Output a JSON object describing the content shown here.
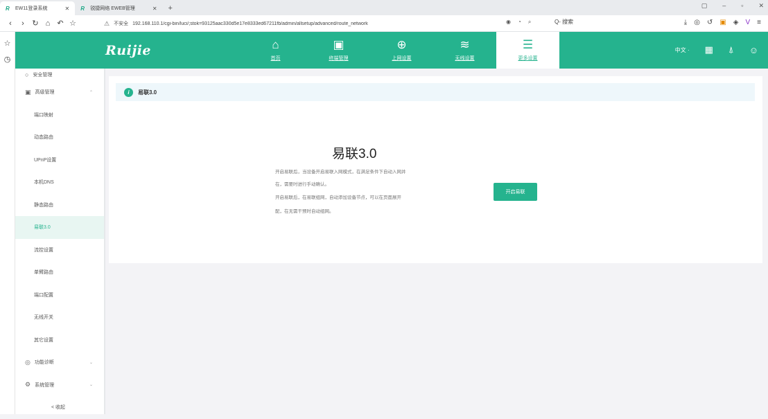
{
  "browser": {
    "tabs": [
      {
        "title": "EW11登录系统",
        "active": true
      },
      {
        "title": "锐捷网络 EWEB管理",
        "active": false
      }
    ],
    "window_controls": [
      "▢",
      "–",
      "▫",
      "✕"
    ],
    "security_label": "不安全",
    "url": "192.168.110.1/cgi-bin/luci/;stok=93125aac330d5e17e8333ed67211fb/admin/allsetup/advanced/route_network",
    "search_text": "Q- 搜索"
  },
  "header": {
    "logo": "Ruijie",
    "menu": [
      {
        "label": "首页",
        "icon": "home-icon",
        "glyph": "⌂",
        "active": false
      },
      {
        "label": "终端管理",
        "icon": "devices-icon",
        "glyph": "▣",
        "active": false
      },
      {
        "label": "上网设置",
        "icon": "globe-icon",
        "glyph": "⊕",
        "active": false
      },
      {
        "label": "无线设置",
        "icon": "wifi-icon",
        "glyph": "≋",
        "active": false
      },
      {
        "label": "更多设置",
        "icon": "settings-sliders-icon",
        "glyph": "☰",
        "active": true
      }
    ],
    "lang": "中文 ·",
    "accent": "#25b38e"
  },
  "sidebar": {
    "items": [
      {
        "label": "安全管理",
        "type": "group",
        "icon": "○",
        "first": true
      },
      {
        "label": "高级管理",
        "type": "group",
        "icon": "▣"
      },
      {
        "label": "端口映射",
        "type": "item"
      },
      {
        "label": "动态路由",
        "type": "item"
      },
      {
        "label": "UPnP设置",
        "type": "item"
      },
      {
        "label": "本机DNS",
        "type": "item"
      },
      {
        "label": "静态路由",
        "type": "item"
      },
      {
        "label": "易联3.0",
        "type": "item",
        "active": true
      },
      {
        "label": "流控设置",
        "type": "item"
      },
      {
        "label": "单臂路由",
        "type": "item"
      },
      {
        "label": "端口配置",
        "type": "item"
      },
      {
        "label": "无线开关",
        "type": "item"
      },
      {
        "label": "其它设置",
        "type": "item"
      },
      {
        "label": "功能诊断",
        "type": "group",
        "icon": "◎"
      },
      {
        "label": "系统管理",
        "type": "group",
        "icon": "⚙"
      }
    ],
    "collapse": "< 收起"
  },
  "content": {
    "breadcrumb": "易联3.0",
    "title": "易联3.0",
    "desc": [
      "开启易联后，当设备开启易联入网模式，在满足条件下自动入网并",
      "在，需要时进行手动确认。",
      "开启易联后，在易联组网，自动添加设备节点，可以在页面展开",
      "配，在无需干预时自动组网。"
    ],
    "button": "开启易联"
  }
}
